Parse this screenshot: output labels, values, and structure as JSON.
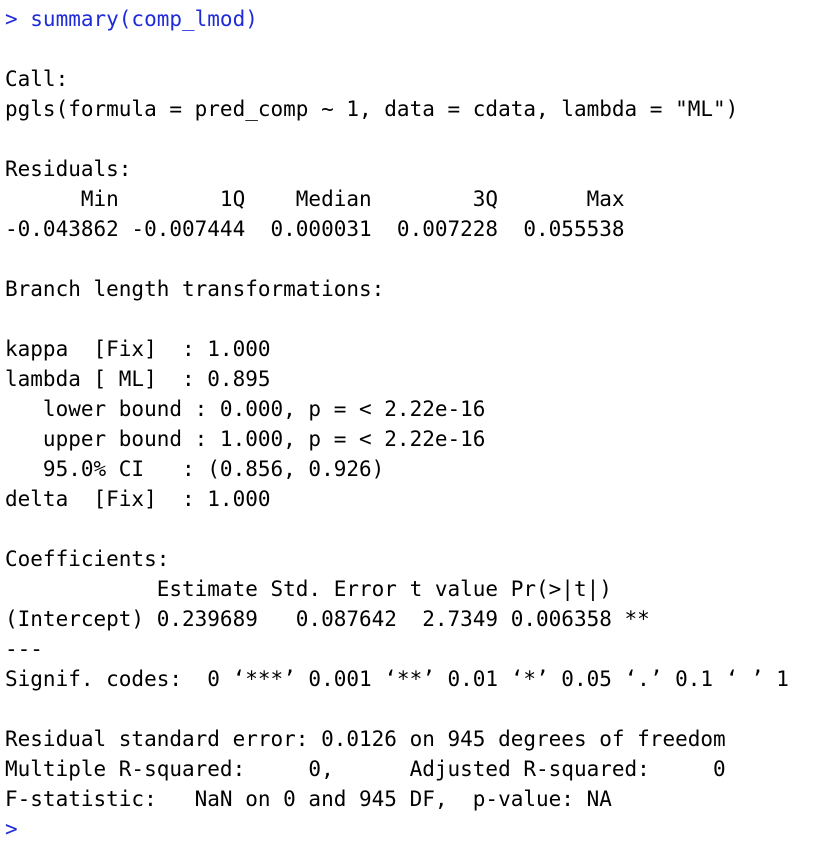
{
  "console": {
    "command_line": "> summary(comp_lmod)",
    "output_lines": [
      "",
      "Call:",
      "pgls(formula = pred_comp ~ 1, data = cdata, lambda = \"ML\")",
      "",
      "Residuals:",
      "      Min        1Q    Median        3Q       Max ",
      "-0.043862 -0.007444  0.000031  0.007228  0.055538 ",
      "",
      "Branch length transformations:",
      "",
      "kappa  [Fix]  : 1.000",
      "lambda [ ML]  : 0.895",
      "   lower bound : 0.000, p = < 2.22e-16",
      "   upper bound : 1.000, p = < 2.22e-16",
      "   95.0% CI   : (0.856, 0.926)",
      "delta  [Fix]  : 1.000",
      "",
      "Coefficients:",
      "            Estimate Std. Error t value Pr(>|t|)   ",
      "(Intercept) 0.239689   0.087642  2.7349 0.006358 **",
      "---",
      "Signif. codes:  0 ‘***’ 0.001 ‘**’ 0.01 ‘*’ 0.05 ‘.’ 0.1 ‘ ’ 1",
      "",
      "Residual standard error: 0.0126 on 945 degrees of freedom",
      "Multiple R-squared:     0,\tAdjusted R-squared:     0 ",
      "F-statistic:   NaN on 0 and 945 DF,  p-value: NA"
    ],
    "prompt": ">"
  },
  "colors": {
    "command": "#1f2bd8",
    "output": "#000000",
    "background": "#ffffff"
  }
}
